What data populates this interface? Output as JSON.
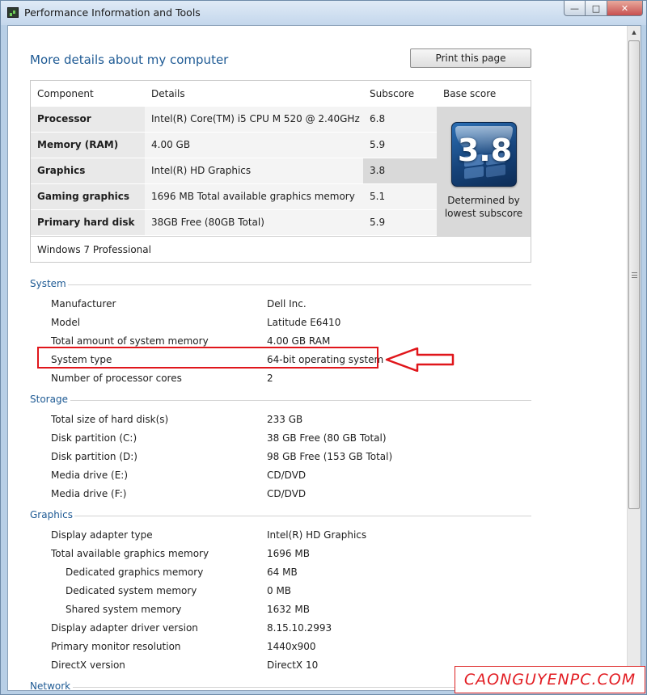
{
  "window": {
    "title": "Performance Information and Tools",
    "controls": {
      "minimize": "—",
      "maximize": "□",
      "close": "✕"
    }
  },
  "header": {
    "title": "More details about my computer",
    "print_label": "Print this page"
  },
  "score_table": {
    "headers": {
      "component": "Component",
      "details": "Details",
      "subscore": "Subscore",
      "base": "Base score"
    },
    "rows": [
      {
        "component": "Processor",
        "details": "Intel(R) Core(TM) i5 CPU M 520 @ 2.40GHz",
        "subscore": "6.8"
      },
      {
        "component": "Memory (RAM)",
        "details": "4.00 GB",
        "subscore": "5.9"
      },
      {
        "component": "Graphics",
        "details": "Intel(R) HD Graphics",
        "subscore": "3.8"
      },
      {
        "component": "Gaming graphics",
        "details": "1696 MB Total available graphics memory",
        "subscore": "5.1"
      },
      {
        "component": "Primary hard disk",
        "details": "38GB Free (80GB Total)",
        "subscore": "5.9"
      }
    ],
    "base_score": "3.8",
    "base_note_line1": "Determined by",
    "base_note_line2": "lowest subscore",
    "os": "Windows 7 Professional"
  },
  "sections": {
    "system": {
      "title": "System",
      "items": [
        {
          "label": "Manufacturer",
          "value": "Dell Inc."
        },
        {
          "label": "Model",
          "value": "Latitude E6410"
        },
        {
          "label": "Total amount of system memory",
          "value": "4.00 GB RAM"
        },
        {
          "label": "System type",
          "value": "64-bit operating system"
        },
        {
          "label": "Number of processor cores",
          "value": "2"
        }
      ]
    },
    "storage": {
      "title": "Storage",
      "items": [
        {
          "label": "Total size of hard disk(s)",
          "value": "233 GB"
        },
        {
          "label": "Disk partition (C:)",
          "value": "38 GB Free (80 GB Total)"
        },
        {
          "label": "Disk partition (D:)",
          "value": "98 GB Free (153 GB Total)"
        },
        {
          "label": "Media drive (E:)",
          "value": "CD/DVD"
        },
        {
          "label": "Media drive (F:)",
          "value": "CD/DVD"
        }
      ]
    },
    "graphics": {
      "title": "Graphics",
      "items": [
        {
          "label": "Display adapter type",
          "value": "Intel(R) HD Graphics"
        },
        {
          "label": "Total available graphics memory",
          "value": "1696 MB"
        },
        {
          "label": "Dedicated graphics memory",
          "value": "64 MB"
        },
        {
          "label": "Dedicated system memory",
          "value": "0 MB"
        },
        {
          "label": "Shared system memory",
          "value": "1632 MB"
        },
        {
          "label": "Display adapter driver version",
          "value": "8.15.10.2993"
        },
        {
          "label": "Primary monitor resolution",
          "value": "1440x900"
        },
        {
          "label": "DirectX version",
          "value": "DirectX 10"
        }
      ]
    },
    "network": {
      "title": "Network"
    }
  },
  "watermark": "CAONGUYENPC.COM",
  "colors": {
    "accent": "#1e5a94",
    "highlight": "#e0161b",
    "badge": "#16437a"
  },
  "icons": [
    "performance-tools-icon",
    "minimize-icon",
    "maximize-icon",
    "close-icon",
    "scroll-up-icon",
    "scroll-down-icon",
    "windows-logo-icon",
    "pointer-arrow-icon"
  ]
}
